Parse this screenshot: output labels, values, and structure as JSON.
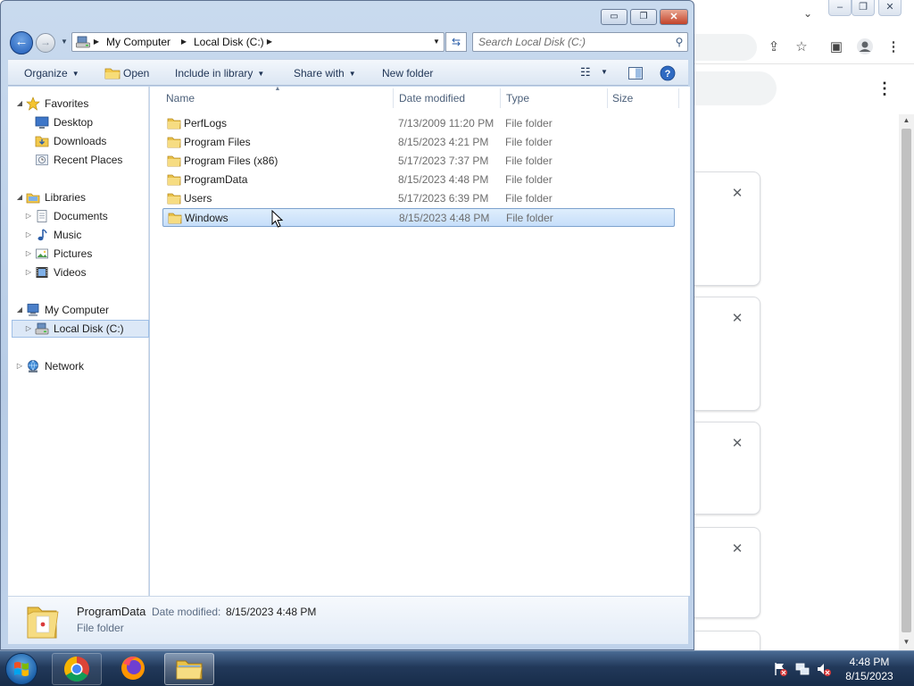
{
  "explorer": {
    "caption": {
      "minimize": "▭",
      "maximize": "❐",
      "close": "✕"
    },
    "address": {
      "crumbs": [
        "My Computer",
        "Local Disk (C:)"
      ]
    },
    "search": {
      "placeholder": "Search Local Disk (C:)"
    },
    "commands": {
      "organize": "Organize",
      "open": "Open",
      "include_in_library": "Include in library",
      "share_with": "Share with",
      "new_folder": "New folder"
    },
    "nav": {
      "favorites": "Favorites",
      "desktop": "Desktop",
      "downloads": "Downloads",
      "recent_places": "Recent Places",
      "libraries": "Libraries",
      "documents": "Documents",
      "music": "Music",
      "pictures": "Pictures",
      "videos": "Videos",
      "my_computer": "My Computer",
      "local_disk": "Local Disk (C:)",
      "network": "Network"
    },
    "columns": {
      "name": "Name",
      "date_modified": "Date modified",
      "type": "Type",
      "size": "Size"
    },
    "files": [
      {
        "name": "PerfLogs",
        "date": "7/13/2009 11:20 PM",
        "type": "File folder",
        "size": ""
      },
      {
        "name": "Program Files",
        "date": "8/15/2023 4:21 PM",
        "type": "File folder",
        "size": ""
      },
      {
        "name": "Program Files (x86)",
        "date": "5/17/2023 7:37 PM",
        "type": "File folder",
        "size": ""
      },
      {
        "name": "ProgramData",
        "date": "8/15/2023 4:48 PM",
        "type": "File folder",
        "size": ""
      },
      {
        "name": "Users",
        "date": "5/17/2023 6:39 PM",
        "type": "File folder",
        "size": ""
      },
      {
        "name": "Windows",
        "date": "8/15/2023 4:48 PM",
        "type": "File folder",
        "size": ""
      }
    ],
    "selected_file": "Windows",
    "details": {
      "name": "ProgramData",
      "date_label": "Date modified:",
      "date_value": "8/15/2023 4:48 PM",
      "type": "File folder"
    }
  },
  "taskbar": {
    "clock_time": "4:48 PM",
    "clock_date": "8/15/2023"
  },
  "colors": {
    "selection_fill": "#cce0f8",
    "selection_border": "#7da2ce",
    "folder_yellow": "#f2c94c",
    "explorer_frame": "#b7cce6",
    "taskbar": "#22395a"
  }
}
